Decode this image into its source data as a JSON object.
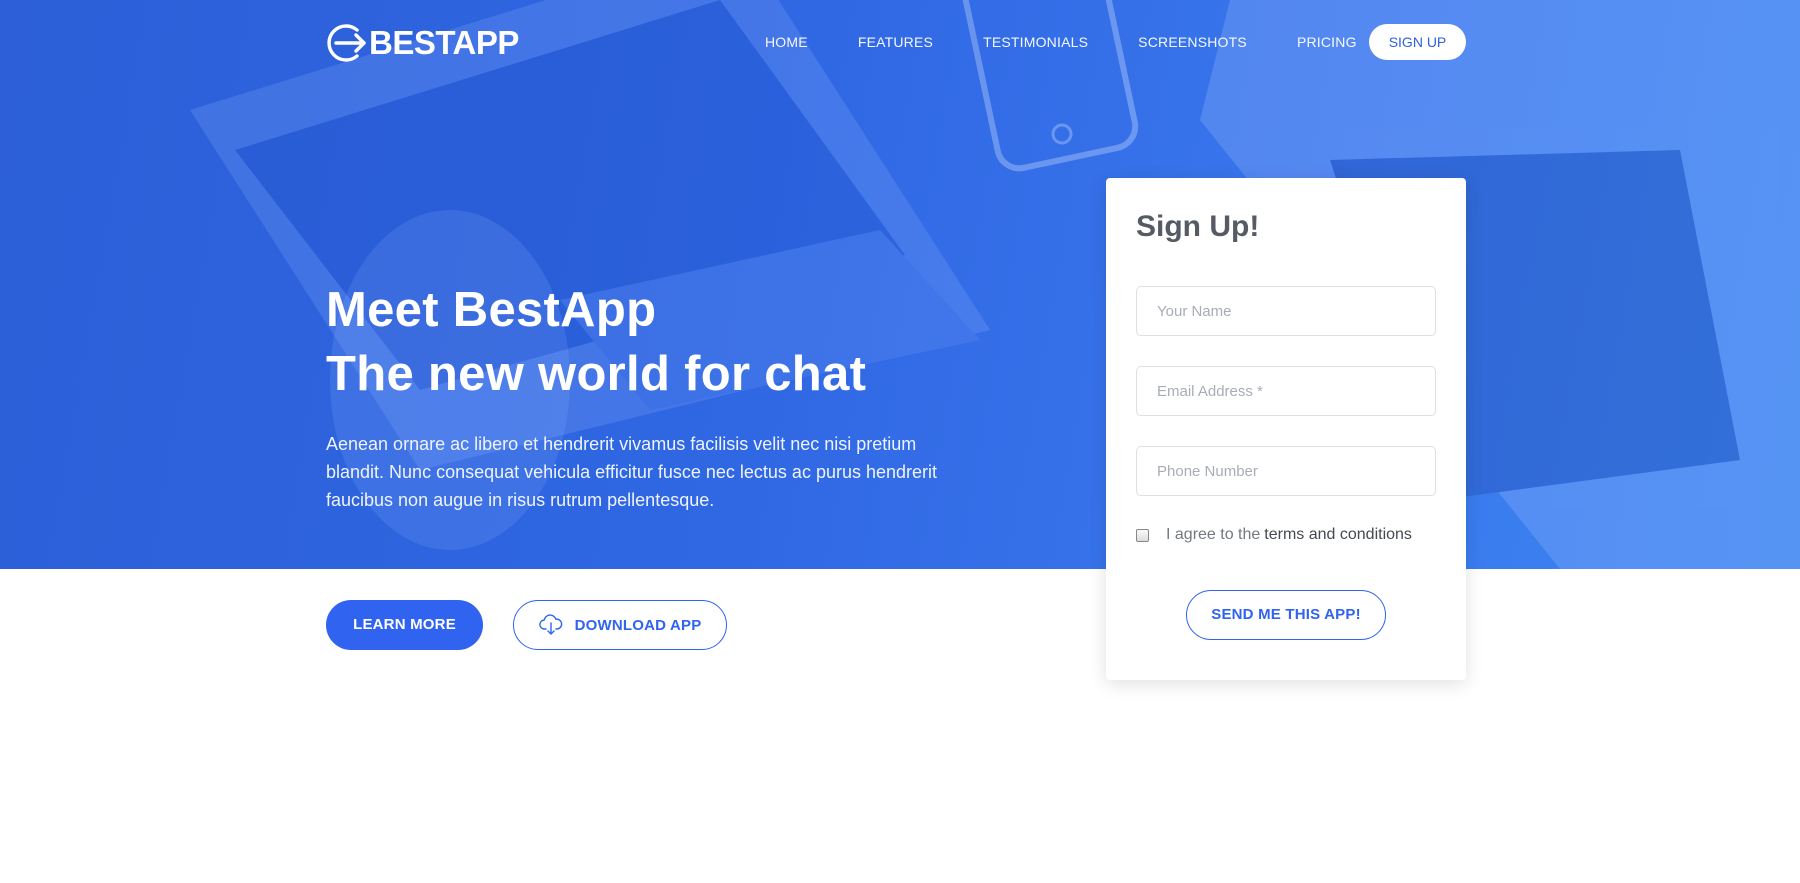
{
  "brand": {
    "name": "BESTAPP",
    "logo_icon": "arrow-in-circle-icon"
  },
  "nav": {
    "links": [
      "HOME",
      "FEATURES",
      "TESTIMONIALS",
      "SCREENSHOTS",
      "PRICING"
    ],
    "signup_label": "SIGN UP"
  },
  "hero": {
    "title_line1": "Meet BestApp",
    "title_line2": "The new world for chat",
    "description": "Aenean ornare ac libero et hendrerit vivamus facilisis velit nec nisi pretium blandit. Nunc consequat vehicula efficitur fusce nec lectus ac purus hendrerit faucibus non augue in risus rutrum pellentesque.",
    "learn_more_label": "LEARN MORE",
    "download_label": "DOWNLOAD APP",
    "download_icon": "cloud-download-icon"
  },
  "signup_form": {
    "title": "Sign Up!",
    "name_placeholder": "Your Name",
    "email_placeholder": "Email Address *",
    "phone_placeholder": "Phone Number",
    "agree_prefix": "I agree to the",
    "terms_link": "terms and conditions",
    "agree_checked": false,
    "submit_label": "SEND ME THIS APP!"
  },
  "colors": {
    "primary": "#2f63f0",
    "hero_overlay": "#2f66e2",
    "card_title": "#555a63"
  }
}
